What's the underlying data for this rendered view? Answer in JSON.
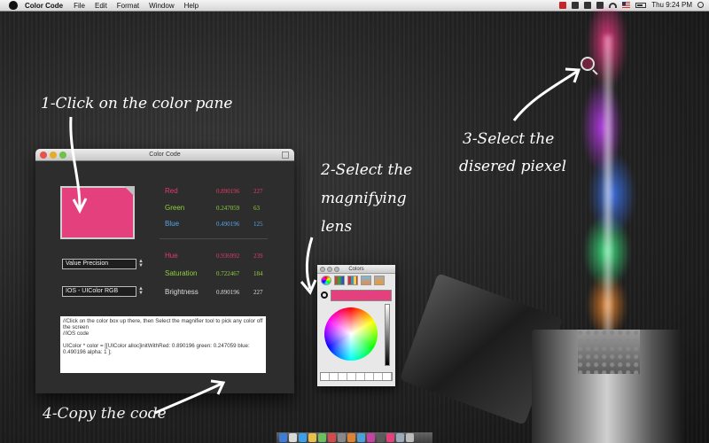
{
  "menubar": {
    "app_name": "Color Code",
    "menus": [
      "File",
      "Edit",
      "Format",
      "Window",
      "Help"
    ],
    "clock": "Thu 9:24 PM",
    "icons": [
      "apple-icon",
      "status-red-icon",
      "wifi-icon",
      "flag-icon",
      "battery-icon",
      "spotlight-icon"
    ]
  },
  "annotations": {
    "step1": "1-Click on the color pane",
    "step2_line1": "2-Select the",
    "step2_line2": "magnifying",
    "step2_line3": "lens",
    "step3_line1": "3-Select the",
    "step3_line2": "disered piexel",
    "step4": "4-Copy the code"
  },
  "window": {
    "title": "Color Code",
    "swatch_color": "#e3407d",
    "rgb_rows": [
      {
        "label": "Red",
        "value": "0.890196",
        "int": "227",
        "color": "#e23c6a"
      },
      {
        "label": "Green",
        "value": "0.247059",
        "int": "63",
        "color": "#8fd13b"
      },
      {
        "label": "Blue",
        "value": "0.490196",
        "int": "125",
        "color": "#56a6e8"
      }
    ],
    "hsb_rows": [
      {
        "label": "Hue",
        "value": "0.936992",
        "int": "239",
        "color": "#e23c6a"
      },
      {
        "label": "Saturation",
        "value": "0.722467",
        "int": "184",
        "color": "#8fd13b"
      },
      {
        "label": "Brightness",
        "value": "0.890196",
        "int": "227",
        "color": "#dddddd"
      }
    ],
    "precision_select": "Value Precision",
    "format_select": "IOS - UIColor RGB",
    "code_lines": [
      "//Click on the color box up there, then Select the magnifier tool to pick any color off the screen",
      "//IOS code",
      "",
      "UIColor * color = [[UIColor alloc]initWithRed: 0.890196 green: 0.247059 blue: 0.490196 alpha: 1 ];"
    ]
  },
  "colors_panel": {
    "title": "Colors",
    "current_color": "#e3407d"
  }
}
